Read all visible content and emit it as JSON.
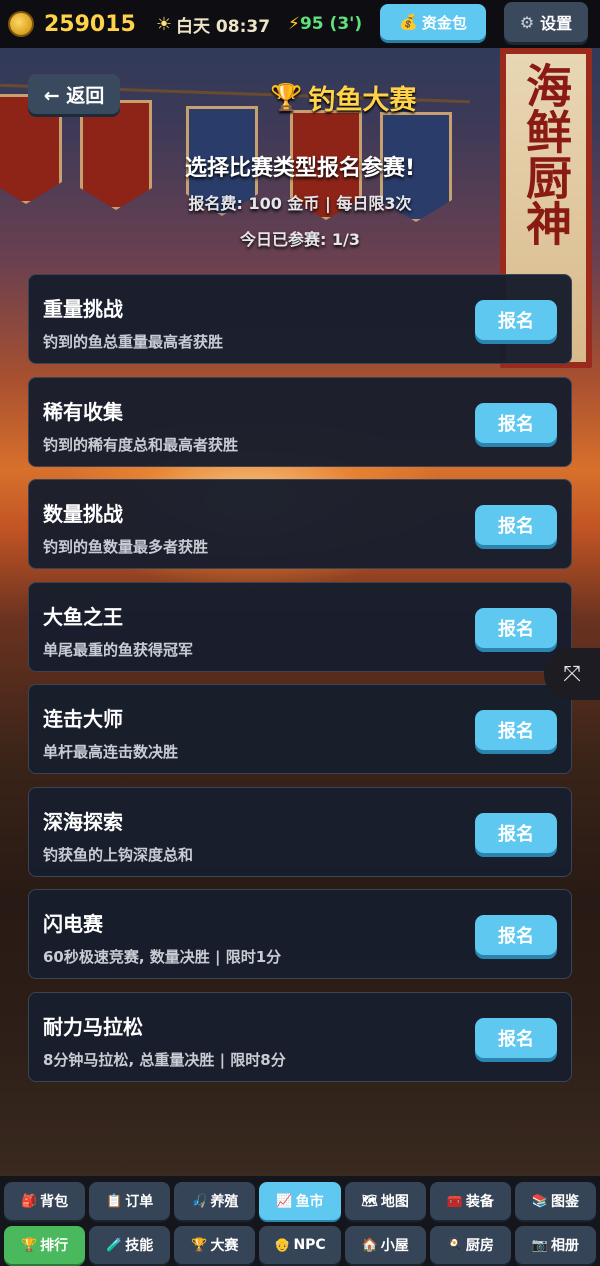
{
  "topbar": {
    "coins": "259015",
    "time": "白天 08:37",
    "energy": "95 (3')",
    "fund_label": "资金包",
    "settings_label": "设置"
  },
  "header": {
    "back_label": "← 返回",
    "title": "钓鱼大赛",
    "subtitle": "选择比赛类型报名参赛!",
    "fee": "报名费: 100 金币 | 每日限3次",
    "joined": "今日已参赛: 1/3"
  },
  "banner_text": "海鲜厨神",
  "contests": [
    {
      "title": "重量挑战",
      "desc": "钓到的鱼总重量最高者获胜",
      "button": "报名"
    },
    {
      "title": "稀有收集",
      "desc": "钓到的稀有度总和最高者获胜",
      "button": "报名"
    },
    {
      "title": "数量挑战",
      "desc": "钓到的鱼数量最多者获胜",
      "button": "报名"
    },
    {
      "title": "大鱼之王",
      "desc": "单尾最重的鱼获得冠军",
      "button": "报名"
    },
    {
      "title": "连击大师",
      "desc": "单杆最高连击数决胜",
      "button": "报名"
    },
    {
      "title": "深海探索",
      "desc": "钓获鱼的上钩深度总和",
      "button": "报名"
    },
    {
      "title": "闪电赛",
      "desc": "60秒极速竞赛, 数量决胜 | 限时1分",
      "button": "报名"
    },
    {
      "title": "耐力马拉松",
      "desc": "8分钟马拉松, 总重量决胜 | 限时8分",
      "button": "报名"
    }
  ],
  "nav": {
    "row1": [
      {
        "icon": "🎒",
        "label": "背包"
      },
      {
        "icon": "📋",
        "label": "订单"
      },
      {
        "icon": "🎣",
        "label": "养殖"
      },
      {
        "icon": "📈",
        "label": "鱼市"
      },
      {
        "icon": "🗺",
        "label": "地图"
      },
      {
        "icon": "🧰",
        "label": "装备"
      },
      {
        "icon": "📚",
        "label": "图鉴"
      }
    ],
    "row2": [
      {
        "icon": "🏆",
        "label": "排行"
      },
      {
        "icon": "🧪",
        "label": "技能"
      },
      {
        "icon": "🏆",
        "label": "大赛"
      },
      {
        "icon": "👴",
        "label": "NPC"
      },
      {
        "icon": "🏠",
        "label": "小屋"
      },
      {
        "icon": "🍳",
        "label": "厨房"
      },
      {
        "icon": "📷",
        "label": "相册"
      }
    ]
  }
}
